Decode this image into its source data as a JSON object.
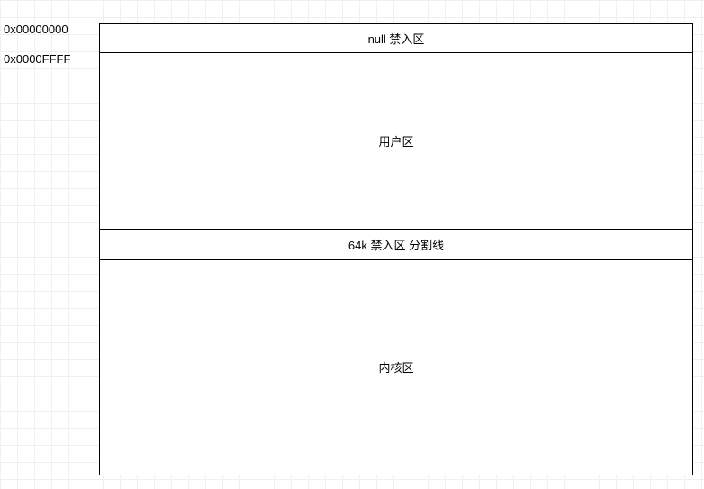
{
  "addresses": {
    "start": "0x00000000",
    "null_end": "0x0000FFFF"
  },
  "regions": {
    "null_zone": "null 禁入区",
    "user_zone": "用户区",
    "divider_zone": "64k 禁入区 分割线",
    "kernel_zone": "内核区"
  }
}
